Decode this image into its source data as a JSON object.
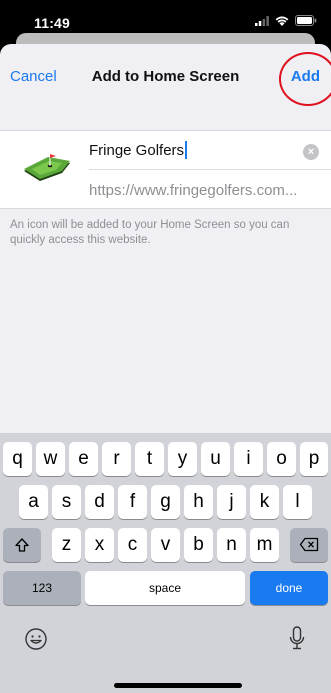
{
  "status_bar": {
    "time": "11:49"
  },
  "nav": {
    "cancel_label": "Cancel",
    "title": "Add to Home Screen",
    "add_label": "Add"
  },
  "bookmark": {
    "name": "Fringe Golfers",
    "url": "https://www.fringegolfers.com...",
    "icon": "golf-green-icon"
  },
  "info_text": "An icon will be added to your Home Screen so you can quickly access this website.",
  "keyboard": {
    "row1": [
      "q",
      "w",
      "e",
      "r",
      "t",
      "y",
      "u",
      "i",
      "o",
      "p"
    ],
    "row2": [
      "a",
      "s",
      "d",
      "f",
      "g",
      "h",
      "j",
      "k",
      "l"
    ],
    "row3": [
      "z",
      "x",
      "c",
      "v",
      "b",
      "n",
      "m"
    ],
    "numbers_label": "123",
    "space_label": "space",
    "done_label": "done"
  },
  "colors": {
    "accent": "#1a7aef",
    "annotation": "#e0101e"
  }
}
